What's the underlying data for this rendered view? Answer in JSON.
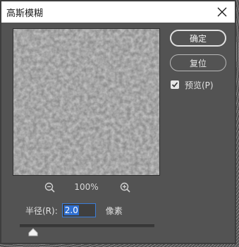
{
  "window": {
    "title": "高斯模糊"
  },
  "buttons": {
    "ok_label": "确定",
    "reset_label": "复位"
  },
  "preview_checkbox": {
    "label": "预览(P)",
    "checked": true
  },
  "zoom": {
    "level": "100%"
  },
  "radius": {
    "label": "半径(R):",
    "value": "2.0",
    "unit": "像素",
    "slider_fraction": 0.1
  },
  "icons": {
    "close": "close-icon",
    "zoom_out": "zoom-out-icon",
    "zoom_in": "zoom-in-icon",
    "checkmark": "checkmark-icon",
    "slider_thumb": "slider-thumb-icon"
  }
}
